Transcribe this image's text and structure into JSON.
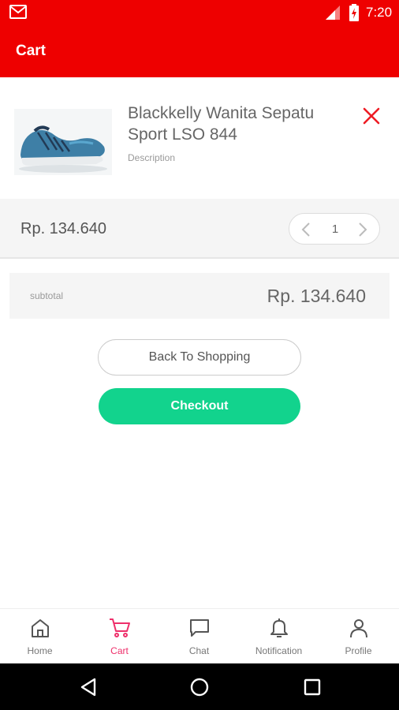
{
  "status_bar": {
    "time": "7:20",
    "icons": [
      "gmail-icon",
      "signal-icon",
      "battery-icon"
    ]
  },
  "app_bar": {
    "title": "Cart"
  },
  "cart_item": {
    "name": "Blackkelly Wanita Sepatu Sport LSO 844",
    "description": "Description",
    "price": "Rp. 134.640",
    "quantity": "1",
    "image": "shoe-product-image"
  },
  "summary": {
    "subtotal_label": "subtotal",
    "subtotal_amount": "Rp. 134.640"
  },
  "actions": {
    "back_label": "Back To Shopping",
    "checkout_label": "Checkout"
  },
  "bottom_nav": {
    "active": "Cart",
    "items": [
      {
        "label": "Home",
        "icon": "home-icon"
      },
      {
        "label": "Cart",
        "icon": "cart-icon"
      },
      {
        "label": "Chat",
        "icon": "chat-icon"
      },
      {
        "label": "Notification",
        "icon": "bell-icon"
      },
      {
        "label": "Profile",
        "icon": "profile-icon"
      }
    ]
  },
  "colors": {
    "primary": "#ee0000",
    "checkout": "#12d38d",
    "active_nav": "#ee2f6a",
    "remove": "#ee1c24"
  }
}
